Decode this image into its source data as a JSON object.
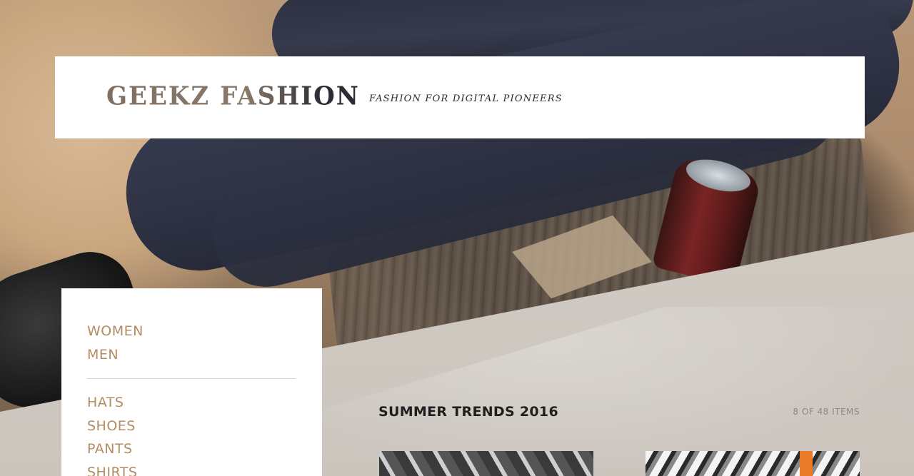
{
  "brand": {
    "logo_text": "GEEKZ FASHION",
    "tagline": "FASHION FOR DIGITAL PIONEERS"
  },
  "sidebar": {
    "primary_items": [
      {
        "label": "WOMEN"
      },
      {
        "label": "MEN"
      }
    ],
    "category_items": [
      {
        "label": "HATS"
      },
      {
        "label": "SHOES"
      },
      {
        "label": "PANTS"
      },
      {
        "label": "SHIRTS"
      }
    ]
  },
  "main": {
    "section_title": "SUMMER TRENDS 2016",
    "item_count": "8 OF 48 ITEMS",
    "products": [
      {
        "image": "graphic-print-shirt-photo"
      },
      {
        "image": "patterned-outfit-photo"
      }
    ]
  },
  "colors": {
    "accent": "#b28d63",
    "title": "#1f1f1f",
    "muted": "#8f8983",
    "panel": "#ffffff",
    "background": "#cfc9c2"
  }
}
